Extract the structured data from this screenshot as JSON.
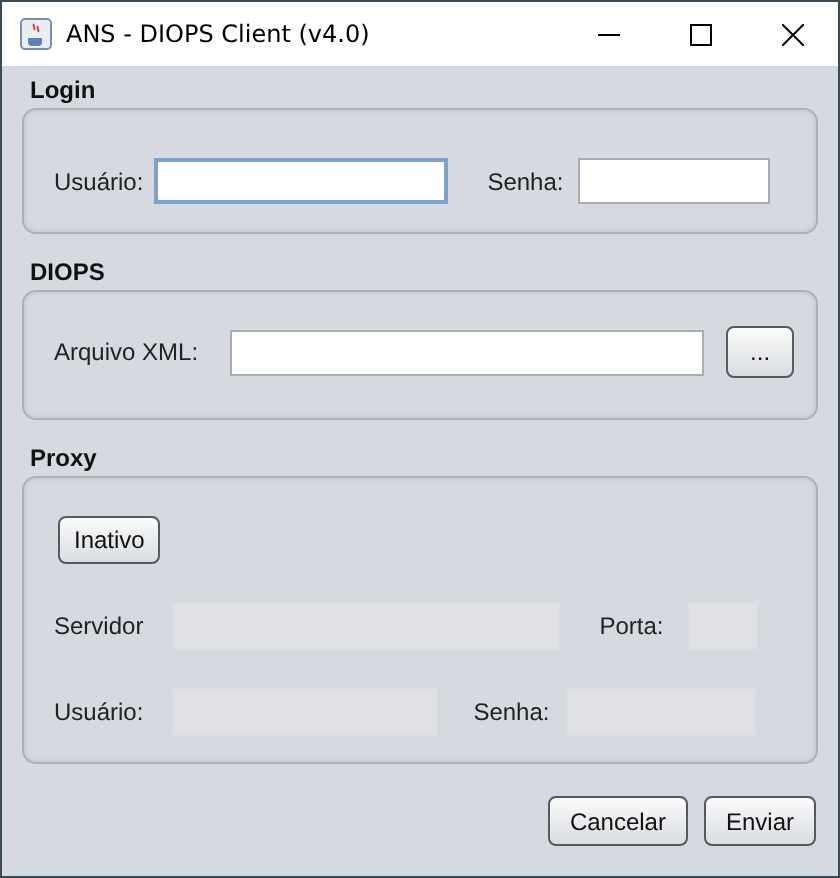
{
  "window": {
    "title": "ANS - DIOPS Client (v4.0)"
  },
  "login": {
    "heading": "Login",
    "user_label": "Usuário:",
    "user_field": {
      "focused": true
    },
    "password_label": "Senha:",
    "password_field": {
      "focused": false
    }
  },
  "diops": {
    "heading": "DIOPS",
    "file_label": "Arquivo XML:",
    "browse_button": "..."
  },
  "proxy": {
    "heading": "Proxy",
    "toggle_button": "Inativo",
    "disabled": true,
    "server_label": "Servidor",
    "port_label": "Porta:",
    "user_label": "Usuário:",
    "password_label": "Senha:"
  },
  "buttons": [
    "Cancelar",
    "Enviar"
  ]
}
